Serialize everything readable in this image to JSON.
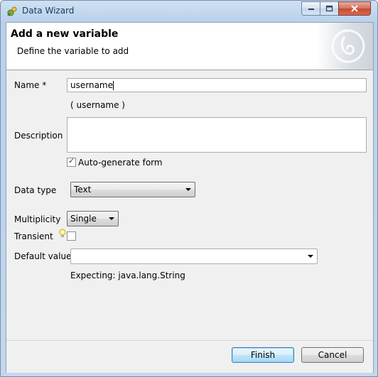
{
  "window": {
    "title": "Data Wizard"
  },
  "header": {
    "title": "Add a new variable",
    "description": "Define the variable to add"
  },
  "form": {
    "name_label": "Name *",
    "name_value": "username",
    "name_preview": "(  username  )",
    "description_label": "Description",
    "description_value": "",
    "autogen_label": "Auto-generate form",
    "autogen_checked": true,
    "datatype_label": "Data type",
    "datatype_value": "Text",
    "multiplicity_label": "Multiplicity",
    "multiplicity_value": "Single",
    "transient_label": "Transient",
    "transient_checked": false,
    "default_label": "Default value",
    "default_value": "",
    "expecting_text": "Expecting: java.lang.String"
  },
  "buttons": {
    "finish": "Finish",
    "cancel": "Cancel"
  },
  "colors": {
    "titlebar": "#b9d1ea",
    "close_button": "#c44a32",
    "default_button_border": "#3c7fb1",
    "dialog_bg": "#f0f0f0"
  }
}
